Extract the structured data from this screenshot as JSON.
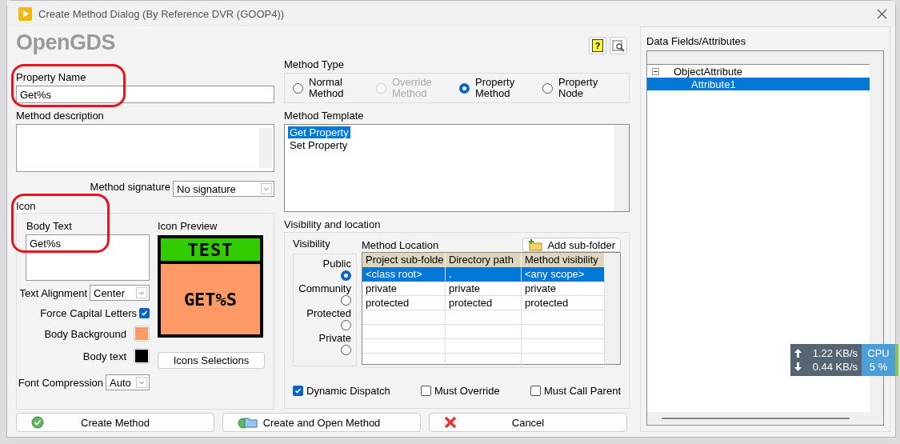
{
  "window": {
    "title": "Create Method Dialog (By Reference DVR (GOOP4))"
  },
  "logo": {
    "text": "OpenGDS"
  },
  "help_button": "?",
  "property_name": {
    "label": "Property Name",
    "value": "Get%s"
  },
  "method_description": {
    "label": "Method description"
  },
  "method_signature": {
    "label": "Method signature",
    "value": "No signature"
  },
  "icon": {
    "title": "Icon",
    "body_text": {
      "label": "Body Text",
      "value": "Get%s"
    },
    "text_alignment": {
      "label": "Text Alignment",
      "value": "Center"
    },
    "force_capital_letters": {
      "label": "Force Capital Letters",
      "checked": true
    },
    "body_background": {
      "label": "Body Background",
      "color": "#ff9966"
    },
    "body_text_color": {
      "label": "Body text",
      "color": "#000000"
    },
    "font_compression": {
      "label": "Font Compression",
      "value": "Auto"
    },
    "preview": {
      "label": "Icon Preview",
      "banner": "TEST",
      "body": "GET%S"
    },
    "selections_button": "Icons Selections"
  },
  "method_type": {
    "label": "Method Type",
    "options": [
      {
        "label": "Normal Method",
        "selected": false,
        "disabled": false
      },
      {
        "label": "Override Method",
        "selected": false,
        "disabled": true
      },
      {
        "label": "Property Method",
        "selected": true,
        "disabled": false
      },
      {
        "label": "Property Node",
        "selected": false,
        "disabled": false
      }
    ]
  },
  "method_template": {
    "label": "Method Template",
    "items": [
      {
        "label": "Get Property",
        "selected": true
      },
      {
        "label": "Set Property",
        "selected": false
      }
    ]
  },
  "visibility_location": {
    "title": "Visibility and location",
    "visibility": {
      "label": "Visibility",
      "options": [
        {
          "label": "Public",
          "selected": true
        },
        {
          "label": "Community",
          "selected": false
        },
        {
          "label": "Protected",
          "selected": false
        },
        {
          "label": "Private",
          "selected": false
        }
      ]
    },
    "method_location": {
      "label": "Method Location",
      "add_button": "Add sub-folder",
      "columns": [
        "Project sub-folde",
        "Directory path",
        "Method visibility"
      ],
      "rows": [
        {
          "cells": [
            "<class root>",
            ".",
            "<any scope>"
          ],
          "selected": true
        },
        {
          "cells": [
            "private",
            "private",
            "private"
          ],
          "selected": false
        },
        {
          "cells": [
            "protected",
            "protected",
            "protected"
          ],
          "selected": false
        }
      ]
    },
    "options": [
      {
        "label": "Dynamic Dispatch",
        "checked": true
      },
      {
        "label": "Must Override",
        "checked": false
      },
      {
        "label": "Must Call Parent",
        "checked": false
      }
    ]
  },
  "buttons": [
    {
      "label": "Create Method",
      "kind": "create"
    },
    {
      "label": "Create and Open Method",
      "kind": "create-open"
    },
    {
      "label": "Cancel",
      "kind": "cancel"
    }
  ],
  "data_fields": {
    "label": "Data Fields/Attributes",
    "tree": [
      {
        "label": "ObjectAttribute",
        "expanded": true,
        "selected": false,
        "children": [
          {
            "label": "Attribute1",
            "selected": true
          }
        ]
      }
    ]
  },
  "network_monitor": {
    "upload": "1.22 KB/s",
    "download": "0.44 KB/s",
    "cpu_label": "CPU",
    "cpu_value": "5 %"
  }
}
